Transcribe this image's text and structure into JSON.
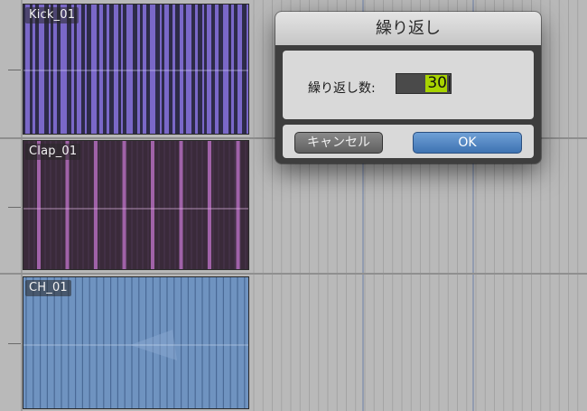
{
  "tracks": [
    {
      "name": "Kick_01",
      "color": "#7a68c8"
    },
    {
      "name": "Clap_01",
      "color": "#a062a8"
    },
    {
      "name": "CH_01",
      "color": "#6f93c0"
    }
  ],
  "dialog": {
    "title": "繰り返し",
    "repeat_label": "繰り返し数:",
    "repeat_value": "30",
    "cancel_label": "キャンセル",
    "ok_label": "OK"
  },
  "colors": {
    "timeline_bg": "#b9b9b9",
    "input_highlight": "#a8d400",
    "ok_button": "#4a80c0"
  }
}
